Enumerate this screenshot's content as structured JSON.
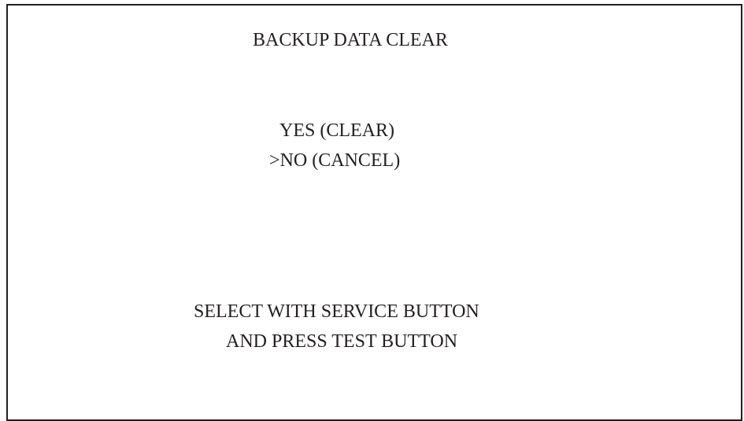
{
  "screen": {
    "title": "BACKUP DATA CLEAR",
    "options": [
      {
        "label": "YES (CLEAR)"
      },
      {
        "label": ">NO (CANCEL)"
      }
    ],
    "instructions": [
      "SELECT WITH SERVICE BUTTON",
      "AND PRESS TEST BUTTON"
    ]
  },
  "colors": {
    "text": "#231f20",
    "border": "#231f20",
    "background": "#ffffff"
  }
}
